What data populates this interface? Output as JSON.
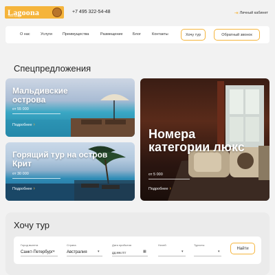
{
  "header": {
    "logo_text": "Lagoona",
    "logo_sub": "travel agency",
    "phone": "+7 495 322-54-48",
    "cabinet_label": "Личный кабинет"
  },
  "nav": {
    "items": [
      "О нас",
      "Услуги",
      "Преимущества",
      "Размещение",
      "Блог",
      "Контакты"
    ],
    "tour_button": "Хочу тур",
    "callback_button": "Обратный звонок"
  },
  "offers": {
    "title": "Спецпредложения",
    "cards": [
      {
        "title": "Мальдивские острова",
        "price": "от 55 000",
        "more": "Подробнее"
      },
      {
        "title": "Горящий тур на остров Крит",
        "price": "от 30 000",
        "more": "Подробнее"
      },
      {
        "title": "Номера категории люкс",
        "price": "от 5 000",
        "more": "Подробнее"
      }
    ]
  },
  "tour_form": {
    "title": "Хочу тур",
    "fields": [
      {
        "label": "Город вылета",
        "value": "Санкт-Петербург"
      },
      {
        "label": "Страна",
        "value": "Австралия"
      },
      {
        "label": "Дата прибытия",
        "value": "дд.мм.гггг"
      },
      {
        "label": "Ночей",
        "value": ""
      },
      {
        "label": "Туристы",
        "value": ""
      }
    ],
    "search_button": "Найти"
  },
  "colors": {
    "accent": "#f5b43b",
    "background": "#f2f2f2"
  }
}
